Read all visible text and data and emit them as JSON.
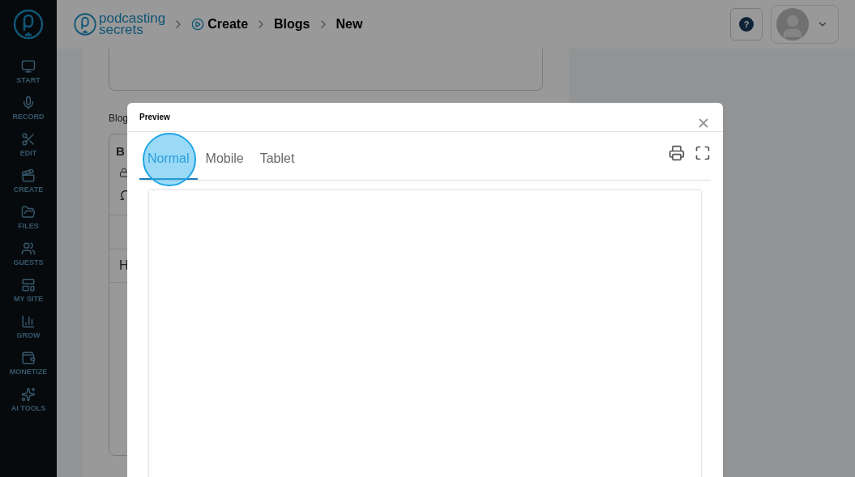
{
  "brand": {
    "line1": "podcasting",
    "line2": "secrets"
  },
  "sidebar": {
    "items": [
      {
        "label": "START"
      },
      {
        "label": "RECORD"
      },
      {
        "label": "EDIT"
      },
      {
        "label": "CREATE"
      },
      {
        "label": "FILES"
      },
      {
        "label": "GUESTS"
      },
      {
        "label": "MY SITE"
      },
      {
        "label": "GROW"
      },
      {
        "label": "MONETIZE"
      },
      {
        "label": "AI TOOLS"
      }
    ]
  },
  "breadcrumb": [
    "Create",
    "Blogs",
    "New"
  ],
  "help_button": {
    "label": "?"
  },
  "background_form": {
    "label": "Blog",
    "editor_heading": "B",
    "editor_paragraph": "H"
  },
  "modal": {
    "title": "Preview",
    "tabs": [
      {
        "label": "Normal",
        "selected": true
      },
      {
        "label": "Mobile",
        "selected": false
      },
      {
        "label": "Tablet",
        "selected": false
      }
    ],
    "click_marker": true
  }
}
